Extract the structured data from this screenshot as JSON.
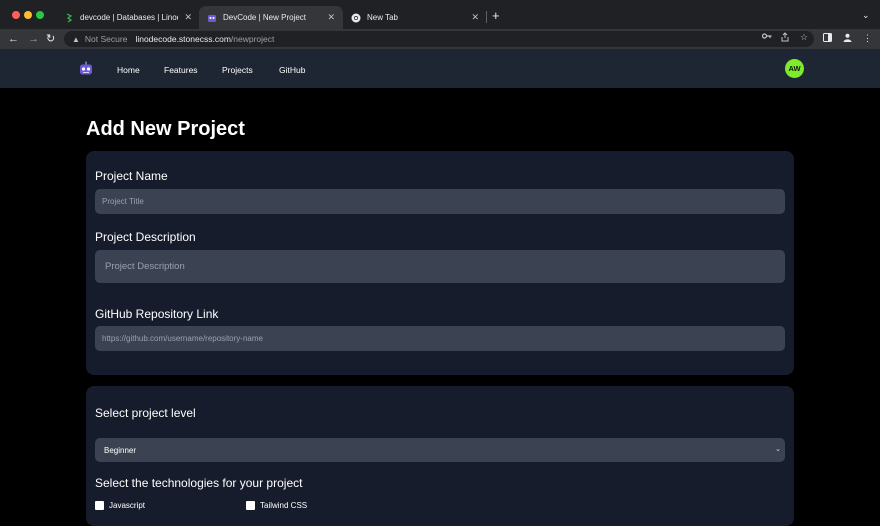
{
  "browser": {
    "tabs": [
      {
        "title": "devcode | Databases | Linode I",
        "close": "✕"
      },
      {
        "title": "DevCode | New Project",
        "close": "✕"
      },
      {
        "title": "New Tab",
        "close": "✕"
      }
    ],
    "new_tab": "+",
    "tab_menu": "⌄",
    "nav": {
      "back": "←",
      "forward": "→",
      "reload": "↻"
    },
    "security_label": "Not Secure",
    "url_host": "linodecode.stonecss.com",
    "url_path": "/newproject"
  },
  "site_nav": {
    "links": [
      "Home",
      "Features",
      "Projects",
      "GitHub"
    ],
    "avatar_initials": "AW"
  },
  "page": {
    "title": "Add New Project",
    "project_name": {
      "label": "Project Name",
      "placeholder": "Project Title",
      "value": ""
    },
    "project_description": {
      "label": "Project Description",
      "placeholder": "Project Description",
      "value": ""
    },
    "repo_link": {
      "label": "GitHub Repository Link",
      "placeholder": "https://github.com/username/repository-name",
      "value": ""
    },
    "level": {
      "label": "Select project level",
      "selected": "Beginner"
    },
    "technologies": {
      "label": "Select the technologies for your project",
      "options": [
        {
          "label": "Javascript",
          "checked": false
        },
        {
          "label": "Tailwind CSS",
          "checked": false
        }
      ]
    }
  },
  "colors": {
    "nav_bg": "#1e2533",
    "card_bg": "#161c2b",
    "field_bg": "#3b4252",
    "avatar_bg": "#7dea2e"
  }
}
